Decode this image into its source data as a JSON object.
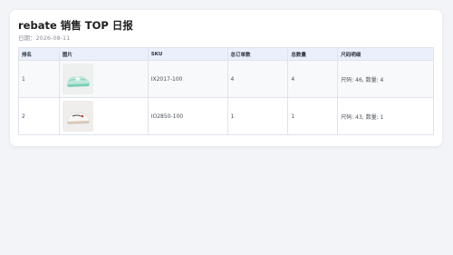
{
  "report": {
    "title": "rebate 销售 TOP 日报",
    "date_label": "日期：2026-08-11"
  },
  "table": {
    "headers": {
      "rank": "排名",
      "image": "图片",
      "sku": "SKU",
      "total_orders": "总订单数",
      "total_qty": "总数量",
      "size_detail": "尺码明细"
    },
    "rows": [
      {
        "rank": "1",
        "sku": "IX2017-100",
        "total_orders": "4",
        "total_qty": "4",
        "size_detail": "尺码: 46, 数量: 4",
        "image_icon": "mint-sneaker-icon"
      },
      {
        "rank": "2",
        "sku": "IO2850-100",
        "total_orders": "1",
        "total_qty": "1",
        "size_detail": "尺码: 43, 数量: 1",
        "image_icon": "white-sneaker-icon"
      }
    ]
  },
  "colors": {
    "page_bg": "#f3f4f8",
    "header_bg": "#eaf0fb",
    "border": "#dfe3ea"
  }
}
